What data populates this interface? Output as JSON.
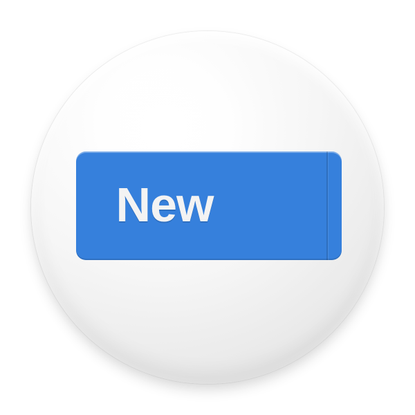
{
  "button": {
    "label": "New"
  },
  "icons": {
    "dropdown": "chevron-down-icon"
  },
  "colors": {
    "button_blue": "#3680dc",
    "label": "#f3f3f3"
  }
}
